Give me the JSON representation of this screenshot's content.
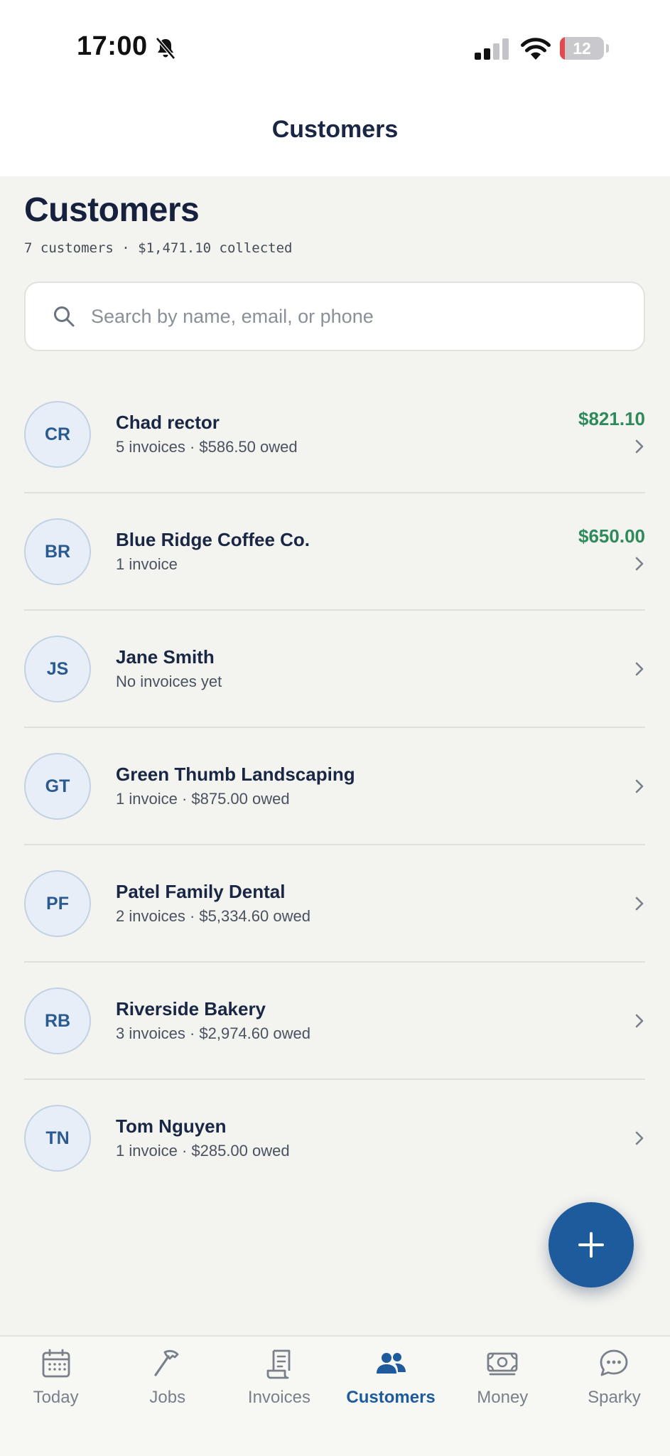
{
  "status_bar": {
    "time": "17:00",
    "battery_level": "12",
    "battery_fraction": 0.12
  },
  "nav": {
    "title": "Customers"
  },
  "page": {
    "title": "Customers",
    "subtitle": "7 customers · $1,471.10 collected"
  },
  "search": {
    "placeholder": "Search by name, email, or phone",
    "value": ""
  },
  "customers": [
    {
      "initials": "CR",
      "name": "Chad rector",
      "detail": "5 invoices · $586.50 owed",
      "amount": "$821.10"
    },
    {
      "initials": "BR",
      "name": "Blue Ridge Coffee Co.",
      "detail": "1 invoice",
      "amount": "$650.00"
    },
    {
      "initials": "JS",
      "name": "Jane Smith",
      "detail": "No invoices yet",
      "amount": ""
    },
    {
      "initials": "GT",
      "name": "Green Thumb Landscaping",
      "detail": "1 invoice · $875.00 owed",
      "amount": ""
    },
    {
      "initials": "PF",
      "name": "Patel Family Dental",
      "detail": "2 invoices · $5,334.60 owed",
      "amount": ""
    },
    {
      "initials": "RB",
      "name": "Riverside Bakery",
      "detail": "3 invoices · $2,974.60 owed",
      "amount": ""
    },
    {
      "initials": "TN",
      "name": "Tom Nguyen",
      "detail": "1 invoice · $285.00 owed",
      "amount": ""
    }
  ],
  "fab": {
    "icon": "plus-icon"
  },
  "tabs": [
    {
      "label": "Today",
      "icon": "calendar-icon",
      "active": false
    },
    {
      "label": "Jobs",
      "icon": "hammer-icon",
      "active": false
    },
    {
      "label": "Invoices",
      "icon": "receipt-icon",
      "active": false
    },
    {
      "label": "Customers",
      "icon": "people-icon",
      "active": true
    },
    {
      "label": "Money",
      "icon": "cash-icon",
      "active": false
    },
    {
      "label": "Sparky",
      "icon": "chat-bubble-icon",
      "active": false
    }
  ],
  "colors": {
    "brand": "#1e5b9c",
    "positive": "#2e8a5a",
    "text_primary": "#1a2744",
    "background": "#f3f3ef"
  }
}
